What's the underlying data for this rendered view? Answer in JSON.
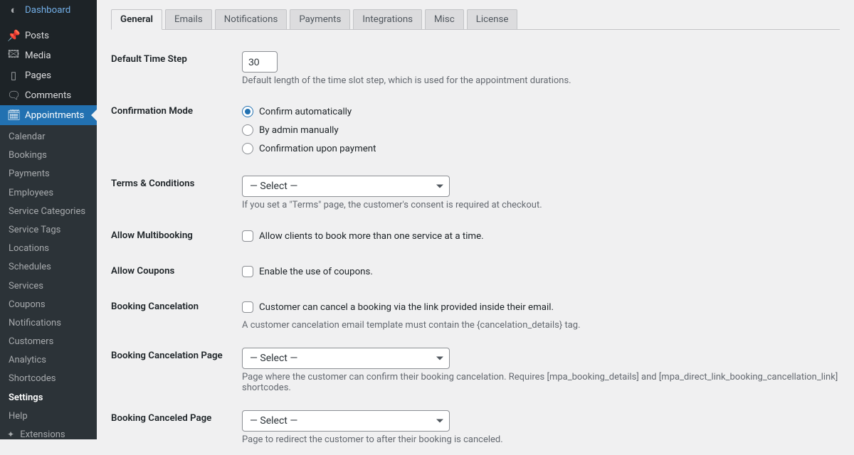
{
  "sidebar": {
    "main": [
      {
        "icon": "◐",
        "label": "Dashboard"
      },
      {
        "icon": "✎",
        "label": "Posts"
      },
      {
        "icon": "❐",
        "label": "Media"
      },
      {
        "icon": "▮",
        "label": "Pages"
      },
      {
        "icon": "🗨",
        "label": "Comments"
      },
      {
        "icon": "📅",
        "label": "Appointments",
        "active": true
      }
    ],
    "sub": [
      "Calendar",
      "Bookings",
      "Payments",
      "Employees",
      "Service Categories",
      "Service Tags",
      "Locations",
      "Schedules",
      "Services",
      "Coupons",
      "Notifications",
      "Customers",
      "Analytics",
      "Shortcodes",
      "Settings",
      "Help"
    ],
    "extensions_label": "Extensions"
  },
  "tabs": [
    "General",
    "Emails",
    "Notifications",
    "Payments",
    "Integrations",
    "Misc",
    "License"
  ],
  "fields": {
    "default_time_step": {
      "label": "Default Time Step",
      "value": "30",
      "desc": "Default length of the time slot step, which is used for the appointment durations."
    },
    "confirmation_mode": {
      "label": "Confirmation Mode",
      "options": [
        "Confirm automatically",
        "By admin manually",
        "Confirmation upon payment"
      ],
      "selected": 0
    },
    "terms": {
      "label": "Terms & Conditions",
      "placeholder": "— Select —",
      "desc": "If you set a \"Terms\" page, the customer's consent is required at checkout."
    },
    "multibooking": {
      "label": "Allow Multibooking",
      "check_label": "Allow clients to book more than one service at a time."
    },
    "coupons": {
      "label": "Allow Coupons",
      "check_label": "Enable the use of coupons."
    },
    "booking_cancel": {
      "label": "Booking Cancelation",
      "check_label": "Customer can cancel a booking via the link provided inside their email.",
      "desc": "A customer cancelation email template must contain the {cancelation_details} tag."
    },
    "cancel_page": {
      "label": "Booking Cancelation Page",
      "placeholder": "— Select —",
      "desc": "Page where the customer can confirm their booking cancelation. Requires [mpa_booking_details] and [mpa_direct_link_booking_cancellation_link] shortcodes."
    },
    "canceled_page": {
      "label": "Booking Canceled Page",
      "placeholder": "— Select —",
      "desc": "Page to redirect the customer to after their booking is canceled."
    }
  }
}
